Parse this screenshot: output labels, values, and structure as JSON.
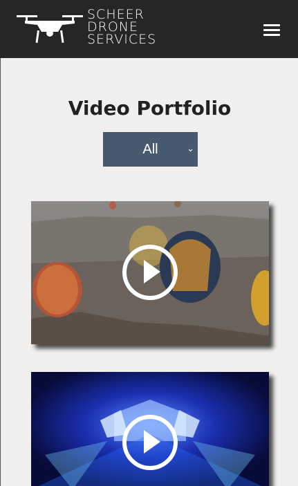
{
  "header": {
    "logo_lines": [
      "SCHEER",
      "DRONE",
      "SERVICES"
    ],
    "logo_icon": "drone-icon",
    "menu_icon": "hamburger-menu-icon"
  },
  "main": {
    "title": "Video Portfolio",
    "filter": {
      "selected": "All",
      "caret_icon": "chevron-down-icon"
    }
  },
  "videos": [
    {
      "thumbnail": "hot-air-balloons-scene",
      "play_icon": "play-icon"
    },
    {
      "thumbnail": "concert-stage-lights-scene",
      "play_icon": "play-icon"
    }
  ],
  "colors": {
    "header_bg": "#262626",
    "page_bg": "#f1f0ef",
    "filter_bg": "#475a70"
  }
}
